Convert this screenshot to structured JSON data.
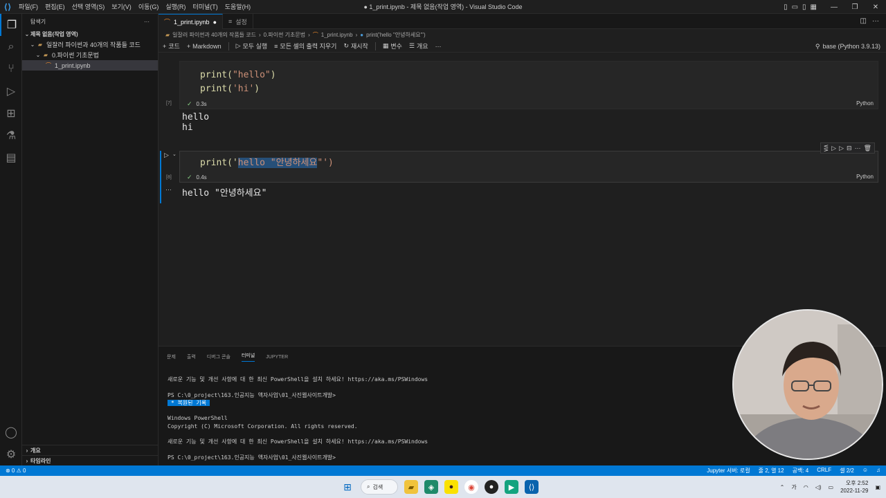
{
  "window": {
    "title": "● 1_print.ipynb - 제목 없음(작업 영역) - Visual Studio Code",
    "menu": [
      "파일(F)",
      "편집(E)",
      "선택 영역(S)",
      "보기(V)",
      "이동(G)",
      "실행(R)",
      "터미널(T)",
      "도움말(H)"
    ]
  },
  "sidebar": {
    "header": "탐색기",
    "workspace": "제목 없음(작업 영역)",
    "folder": "일잘러 파이썬과 40개의 작품들 코드",
    "subfolder": "0.파이썬 기초문법",
    "file": "1_print.ipynb",
    "bottom": [
      "개요",
      "타임라인"
    ]
  },
  "tabs": [
    {
      "label": "1_print.ipynb",
      "dirty": "●"
    },
    {
      "label": "설정"
    }
  ],
  "breadcrumb": [
    "일잘러 파이썬과 40개의 작품들 코드",
    "0.파이썬 기초문법",
    "1_print.ipynb",
    "print('hello \"안녕하세요\"')"
  ],
  "toolbar": {
    "code": "코드",
    "markdown": "Markdown",
    "run_all": "모두 실행",
    "clear_outputs": "모든 셀의 출력 지우기",
    "restart": "재시작",
    "variables": "변수",
    "outline": "개요",
    "kernel": "base (Python 3.9.13)"
  },
  "cells": [
    {
      "exec": "[7]",
      "line1": "print(",
      "line1_str": "\"hello\"",
      "line1_end": ")",
      "line2": "print(",
      "line2_str": "'hi'",
      "line2_end": ")",
      "time": "0.3s",
      "lang": "Python",
      "output": "hello\nhi"
    },
    {
      "exec": "[8]",
      "prefix": "print('",
      "selected": "hello \"안녕하세요",
      "suffix": "\"')",
      "time": "0.4s",
      "lang": "Python",
      "output": "hello \"안녕하세요\""
    }
  ],
  "panel": {
    "tabs": [
      "문제",
      "출력",
      "디버그 콘솔",
      "터미널",
      "JUPYTER"
    ],
    "active_tab": "터미널",
    "term_line1": "새로운 기능 및 개선 사항에 대 한 최신 PowerShell을 설치 하세요! https://aka.ms/PSWindows",
    "term_line2": "PS C:\\0_project\\163.인공지능 액자사업\\01_사진웹사이트개발>",
    "term_hl": " * 복원된 기록 ",
    "term_line3": "Windows PowerShell",
    "term_line4": "Copyright (C) Microsoft Corporation. All rights reserved.",
    "term_line5": "새로운 기능 및 개선 사항에 대 한 최신 PowerShell을 설치 하세요! https://aka.ms/PSWindows",
    "term_line6": "PS C:\\0_project\\163.인공지능 액자사업\\01_사진웹사이트개발>"
  },
  "statusbar": {
    "errors": "⊗ 0 ⚠ 0",
    "jupyter": "Jupyter 서버: 로컬",
    "position": "줄 2, 열 12",
    "spaces": "공백: 4",
    "eol": "CRLF",
    "cell": "셀 2/2"
  },
  "taskbar": {
    "search": "검색",
    "ime": "가",
    "time": "오후 2:52",
    "date": "2022-11-29"
  }
}
